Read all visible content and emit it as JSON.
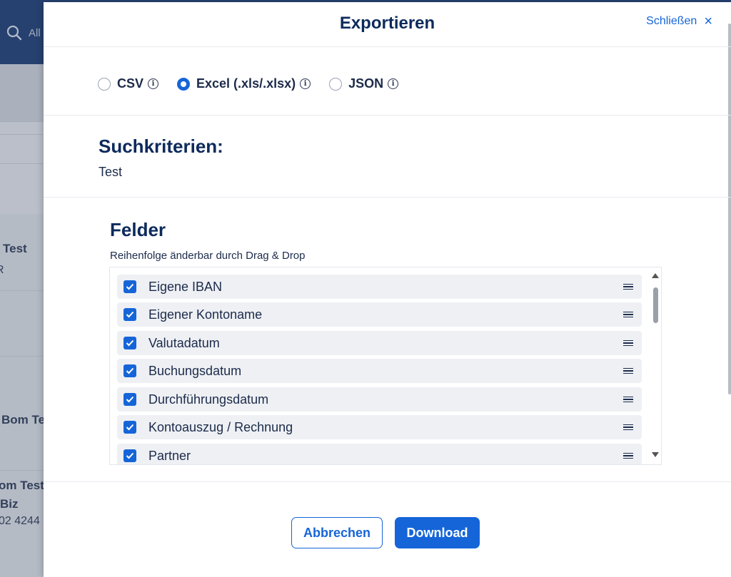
{
  "background": {
    "search_placeholder": "All",
    "rows": [
      {
        "title": "Test",
        "sub": "R"
      },
      {
        "title": "Bom Te",
        "sub": ""
      },
      {
        "title": "om Test",
        "sub": "Biz",
        "extra": "02 4244"
      }
    ]
  },
  "modal": {
    "title": "Exportieren",
    "close_label": "Schließen",
    "formats": [
      {
        "label": "CSV",
        "selected": false
      },
      {
        "label": "Excel (.xls/.xlsx)",
        "selected": true
      },
      {
        "label": "JSON",
        "selected": false
      }
    ],
    "criteria": {
      "heading": "Suchkriterien:",
      "value": "Test"
    },
    "fields": {
      "heading": "Felder",
      "hint": "Reihenfolge änderbar durch Drag & Drop",
      "items": [
        {
          "label": "Eigene IBAN",
          "checked": true
        },
        {
          "label": "Eigener Kontoname",
          "checked": true
        },
        {
          "label": "Valutadatum",
          "checked": true
        },
        {
          "label": "Buchungsdatum",
          "checked": true
        },
        {
          "label": "Durchführungsdatum",
          "checked": true
        },
        {
          "label": "Kontoauszug / Rechnung",
          "checked": true
        },
        {
          "label": "Partner",
          "checked": true
        }
      ]
    },
    "buttons": {
      "cancel": "Abbrechen",
      "download": "Download"
    }
  },
  "colors": {
    "accent": "#1565d8",
    "title": "#0d2a5c",
    "topbar": "#0b2e6b"
  }
}
